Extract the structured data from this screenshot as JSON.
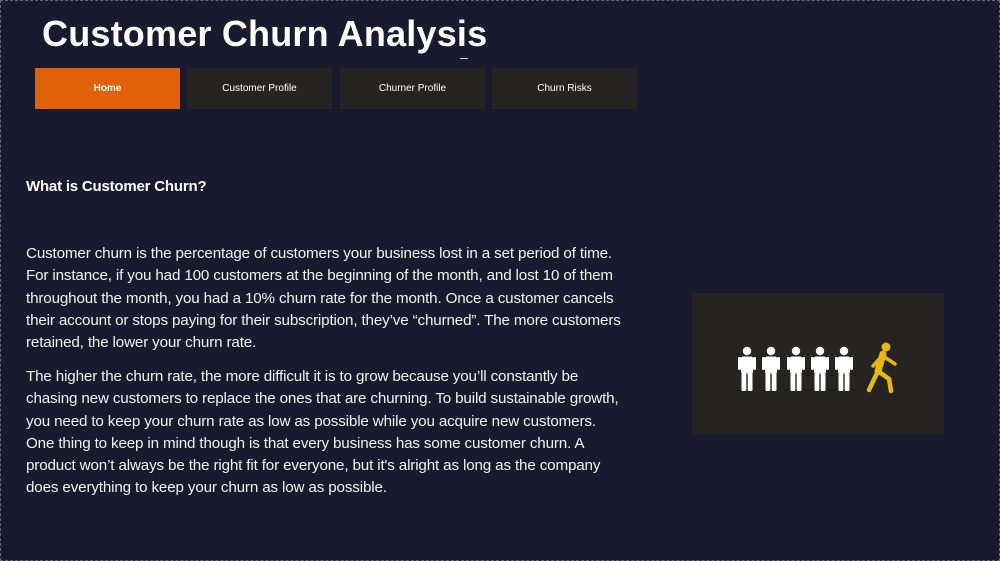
{
  "page": {
    "title": "Customer Churn Analysis"
  },
  "nav": {
    "items": [
      {
        "label": "Home",
        "active": true
      },
      {
        "label": "Customer Profile",
        "active": false
      },
      {
        "label": "Churner Profile",
        "active": false
      },
      {
        "label": "Churn Risks",
        "active": false
      }
    ]
  },
  "content": {
    "heading": "What is Customer Churn?",
    "paragraph_1": "Customer churn is the percentage of customers your business lost in a set period of time. For instance, if you had 100 customers at the beginning of the month, and lost 10 of them throughout the month, you had a 10% churn rate for the month. Once a customer cancels their account or stops paying for their subscription, they’ve “churned”. The more customers retained, the lower your churn rate.",
    "paragraph_2": "The higher the churn rate, the more difficult it is to grow because you’ll constantly be chasing new customers to replace the ones that are churning. To build sustainable growth, you need to keep your churn rate as low as possible while you acquire new customers. One thing to keep in mind though is that every business has some customer churn. A product won’t always be the right fit for everyone, but it's alright as long as the company does everything to keep your churn as low as possible."
  },
  "illustration": {
    "icon": "people-churn-icon",
    "staying_count": 5,
    "leaving_count": 1,
    "staying_color": "#ffffff",
    "leaving_color": "#e8b90c"
  },
  "colors": {
    "background": "#191a2e",
    "nav_active": "#e06107",
    "nav_inactive": "#252423",
    "card": "#252423"
  }
}
